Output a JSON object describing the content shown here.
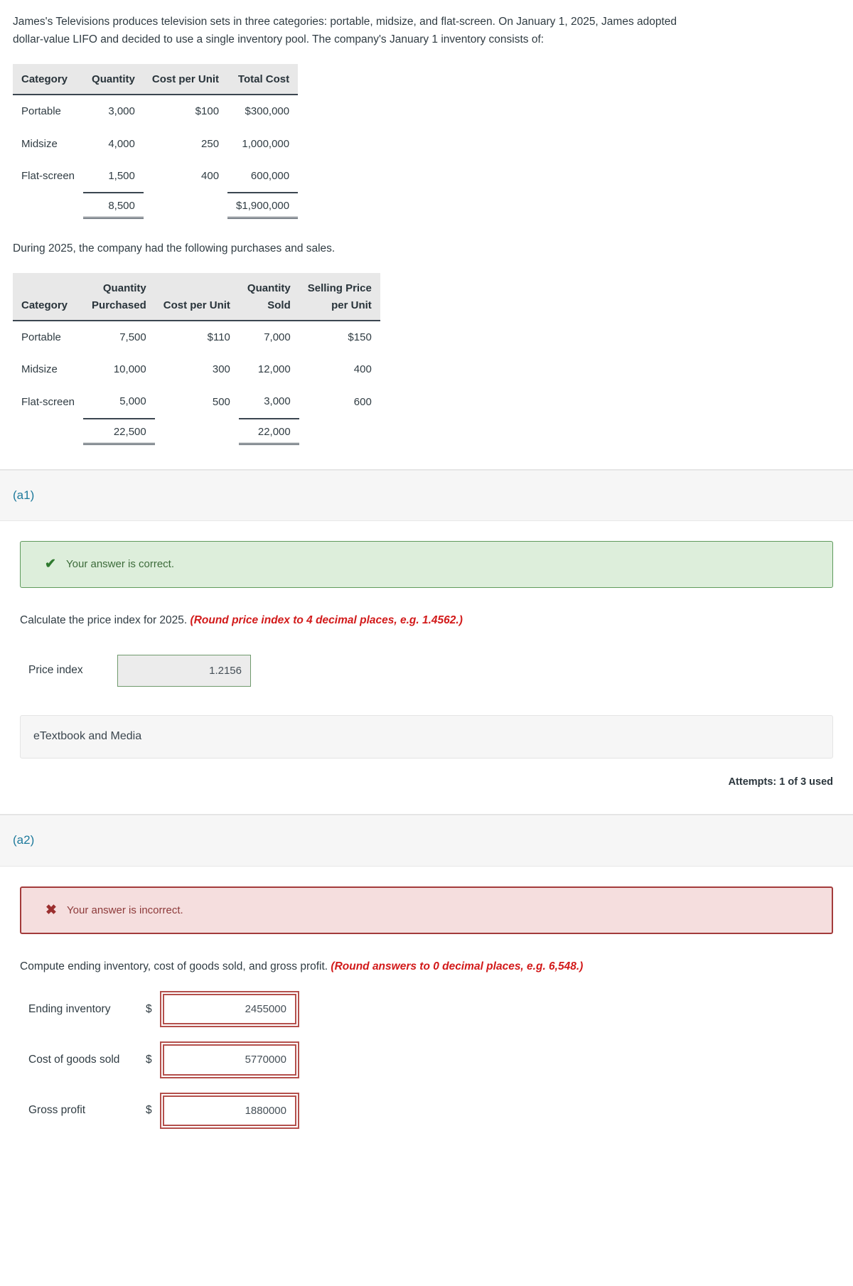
{
  "intro": {
    "paragraph": "James's Televisions produces television sets in three categories: portable, midsize, and flat-screen. On January 1, 2025, James adopted dollar-value LIFO and decided to use a single inventory pool. The company's January 1 inventory consists of:",
    "mid_paragraph": "During 2025, the company had the following purchases and sales."
  },
  "inventory_table": {
    "headers": [
      "Category",
      "Quantity",
      "Cost per Unit",
      "Total Cost"
    ],
    "rows": [
      {
        "category": "Portable",
        "quantity": "3,000",
        "cost_per_unit": "$100",
        "total_cost": "$300,000"
      },
      {
        "category": "Midsize",
        "quantity": "4,000",
        "cost_per_unit": "250",
        "total_cost": "1,000,000"
      },
      {
        "category": "Flat-screen",
        "quantity": "1,500",
        "cost_per_unit": "400",
        "total_cost": "600,000"
      }
    ],
    "totals": {
      "category": "",
      "quantity": "8,500",
      "cost_per_unit": "",
      "total_cost": "$1,900,000"
    }
  },
  "activity_table": {
    "headers": [
      "Category",
      "Quantity\nPurchased",
      "Cost per Unit",
      "Quantity\nSold",
      "Selling Price\nper Unit"
    ],
    "rows": [
      {
        "category": "Portable",
        "qty_purchased": "7,500",
        "cost_per_unit": "$110",
        "qty_sold": "7,000",
        "selling_price": "$150"
      },
      {
        "category": "Midsize",
        "qty_purchased": "10,000",
        "cost_per_unit": "300",
        "qty_sold": "12,000",
        "selling_price": "400"
      },
      {
        "category": "Flat-screen",
        "qty_purchased": "5,000",
        "cost_per_unit": "500",
        "qty_sold": "3,000",
        "selling_price": "600"
      }
    ],
    "totals": {
      "category": "",
      "qty_purchased": "22,500",
      "cost_per_unit": "",
      "qty_sold": "22,000",
      "selling_price": ""
    }
  },
  "part_a1": {
    "label": "(a1)",
    "alert": {
      "icon": "✔",
      "text": "Your answer is correct."
    },
    "prompt_main": "Calculate the price index for 2025. ",
    "prompt_hint": "(Round price index to 4 decimal places, e.g. 1.4562.)",
    "field_label": "Price index",
    "field_value": "1.2156",
    "etextbook_label": "eTextbook and Media",
    "attempts": "Attempts: 1 of 3 used"
  },
  "part_a2": {
    "label": "(a2)",
    "alert": {
      "icon": "✖",
      "text": "Your answer is incorrect."
    },
    "prompt_main": "Compute ending inventory, cost of goods sold, and gross profit. ",
    "prompt_hint": "(Round answers to 0 decimal places, e.g. 6,548.)",
    "fields": [
      {
        "label": "Ending inventory",
        "currency": "$",
        "value": "2455000"
      },
      {
        "label": "Cost of goods sold",
        "currency": "$",
        "value": "5770000"
      },
      {
        "label": "Gross profit",
        "currency": "$",
        "value": "1880000"
      }
    ]
  },
  "colors": {
    "accent_link": "#1e7a9c",
    "hint_red": "#d21a1a",
    "success_bg": "#ddeedb",
    "success_border": "#5f9a5c",
    "error_bg": "#f5dede",
    "error_border": "#a33b3b",
    "field_error_border": "#b4504c",
    "field_ok_border": "#6f9a6c"
  }
}
